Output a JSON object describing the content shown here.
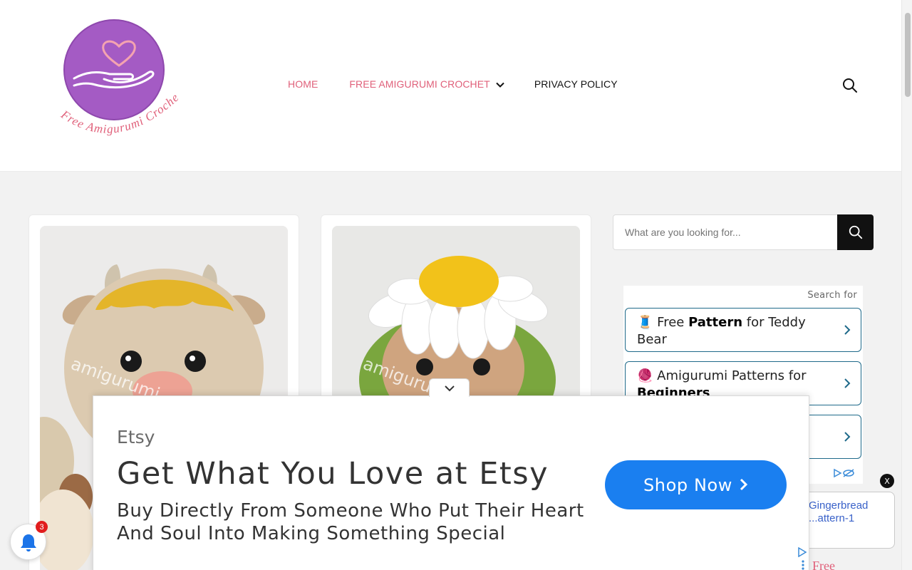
{
  "header": {
    "logo_text": "Free Amigurumi Crochet",
    "nav": {
      "home": "HOME",
      "free_amigurumi": "FREE AMIGURUMI CROCHET",
      "privacy": "PRIVACY POLICY"
    },
    "search_icon": "search-icon"
  },
  "colors": {
    "accent_pink": "#e0607a",
    "logo_purple": "#a45bc4",
    "cta_blue": "#1a7ff0",
    "ad_border": "#1f6a8a",
    "badge_red": "#e11d1d"
  },
  "posts": [
    {
      "image": "crochet cow amigurumi with blond hair",
      "watermark": "amigurumi"
    },
    {
      "image": "crochet daisy doll amigurumi",
      "watermark": "amigurumi"
    }
  ],
  "sidebar": {
    "search_placeholder": "What are you looking for...",
    "ad": {
      "header": "Search for",
      "links": [
        {
          "emoji": "🧵",
          "before": "Free ",
          "bold": "Pattern",
          "after": " for Teddy Bear"
        },
        {
          "emoji": "🧶",
          "before": "Amigurumi Patterns for ",
          "bold": "Beginners",
          "after": ""
        }
      ]
    },
    "ad2_text": "Gingerbread ...attern-1",
    "ad3_text": "Free",
    "ad_close_label": "X"
  },
  "anchor_ad": {
    "brand": "Etsy",
    "headline": "Get What You Love at Etsy",
    "body": "Buy Directly From Someone Who Put Their Heart And Soul Into Making Something Special",
    "cta": "Shop Now"
  },
  "notifications": {
    "count": "3"
  }
}
